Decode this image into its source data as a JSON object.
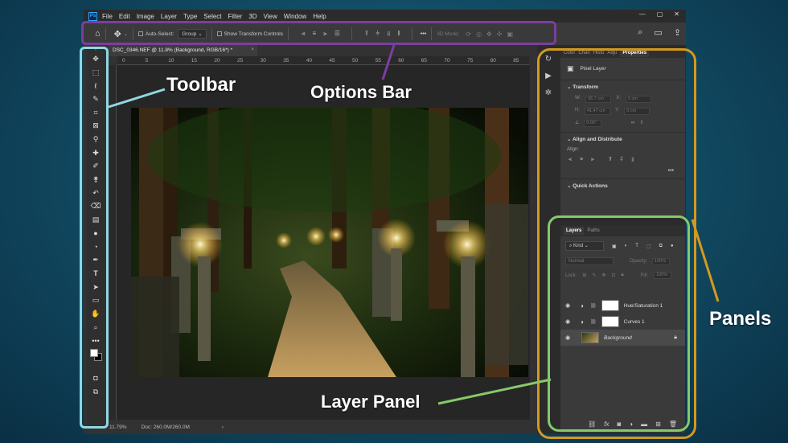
{
  "app": {
    "logo": "Ps",
    "menu": [
      "File",
      "Edit",
      "Image",
      "Layer",
      "Type",
      "Select",
      "Filter",
      "3D",
      "View",
      "Window",
      "Help"
    ],
    "window_controls": [
      "—",
      "▢",
      "✕"
    ]
  },
  "options_bar": {
    "auto_select_label": "Auto-Select:",
    "group_value": "Group",
    "show_transform_label": "Show Transform Controls",
    "more_label": "•••",
    "mode_label": "3D Mode:"
  },
  "document": {
    "tab_title": "DSC_0346.NEF @ 11.8% (Background, RGB/16*) *",
    "close_glyph": "×",
    "ruler_ticks": [
      "0",
      "5",
      "10",
      "15",
      "20",
      "25",
      "30",
      "35",
      "40",
      "45",
      "50",
      "55",
      "60",
      "65",
      "70",
      "75",
      "80",
      "85"
    ],
    "zoom": "11.79%",
    "doc_size": "Doc: 260.0M/260.0M",
    "status_arrow": "›"
  },
  "properties_panel": {
    "tabs": [
      "Color",
      "Chan",
      "Histo",
      "Adju",
      "Properties"
    ],
    "layer_type": "Pixel Layer",
    "transform_section": "Transform",
    "w_label": "W:",
    "w_value": "56.7 cm",
    "x_label": "X:",
    "x_value": "0 cm",
    "h_label": "H:",
    "h_value": "41.47 cm",
    "y_label": "Y:",
    "y_value": "0 cm",
    "angle_value": "0.00°",
    "align_section": "Align and Distribute",
    "align_label": "Align:",
    "more_label": "•••",
    "quick_actions": "Quick Actions"
  },
  "layers_panel": {
    "tabs": [
      "Layers",
      "Paths"
    ],
    "kind_label": "Kind",
    "blend_mode": "Normal",
    "opacity_label": "Opacity:",
    "opacity_value": "100%",
    "lock_label": "Lock:",
    "fill_label": "Fill:",
    "fill_value": "100%",
    "layers": [
      {
        "name": "Hue/Saturation 1",
        "type": "adjustment"
      },
      {
        "name": "Curves 1",
        "type": "adjustment"
      },
      {
        "name": "Background",
        "type": "image",
        "locked": true
      }
    ]
  },
  "callouts": {
    "toolbar": "Toolbar",
    "options_bar": "Options Bar",
    "panels": "Panels",
    "layer_panel": "Layer Panel"
  },
  "colors": {
    "toolbar_callout": "#8fd8e2",
    "options_callout": "#7b3e9f",
    "panels_callout": "#d4991f",
    "layer_callout": "#86c96a"
  }
}
